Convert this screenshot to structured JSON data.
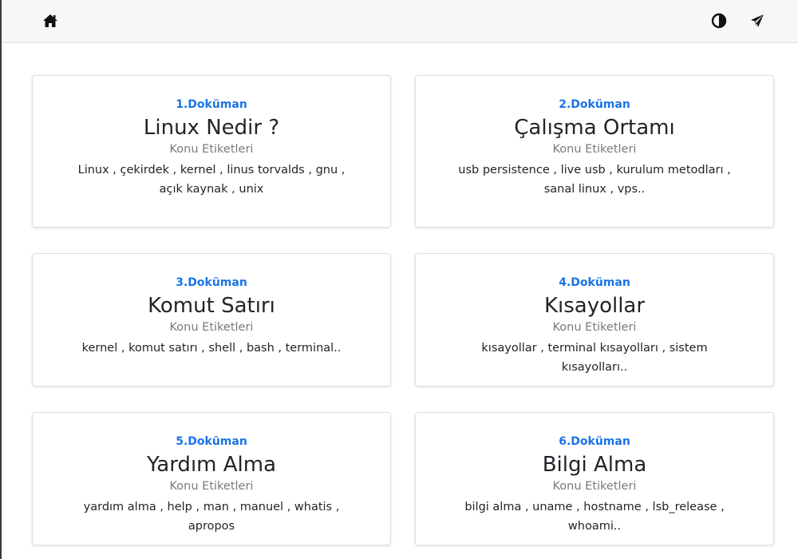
{
  "navbar": {
    "left_icon": "home-icon",
    "right_icons": [
      "contrast-icon",
      "paper-plane-icon"
    ]
  },
  "colors": {
    "accent": "#1a73e8",
    "navbar_bg": "#f7f7f8",
    "subtitle": "#7a7a7a"
  },
  "documents": [
    {
      "number": "1.Doküman",
      "title": "Linux Nedir ?",
      "subtitle": "Konu Etiketleri",
      "tags": "Linux , çekirdek , kernel , linus torvalds , gnu , açık kaynak , unix"
    },
    {
      "number": "2.Doküman",
      "title": "Çalışma Ortamı",
      "subtitle": "Konu Etiketleri",
      "tags": "usb persistence , live usb , kurulum metodları , sanal linux , vps.."
    },
    {
      "number": "3.Doküman",
      "title": "Komut Satırı",
      "subtitle": "Konu Etiketleri",
      "tags": "kernel , komut satırı , shell , bash , terminal.."
    },
    {
      "number": "4.Doküman",
      "title": "Kısayollar",
      "subtitle": "Konu Etiketleri",
      "tags": "kısayollar , terminal kısayolları , sistem kısayolları.."
    },
    {
      "number": "5.Doküman",
      "title": "Yardım Alma",
      "subtitle": "Konu Etiketleri",
      "tags": "yardım alma , help , man , manuel , whatis , apropos"
    },
    {
      "number": "6.Doküman",
      "title": "Bilgi Alma",
      "subtitle": "Konu Etiketleri",
      "tags": "bilgi alma , uname , hostname , lsb_release , whoami.."
    }
  ]
}
